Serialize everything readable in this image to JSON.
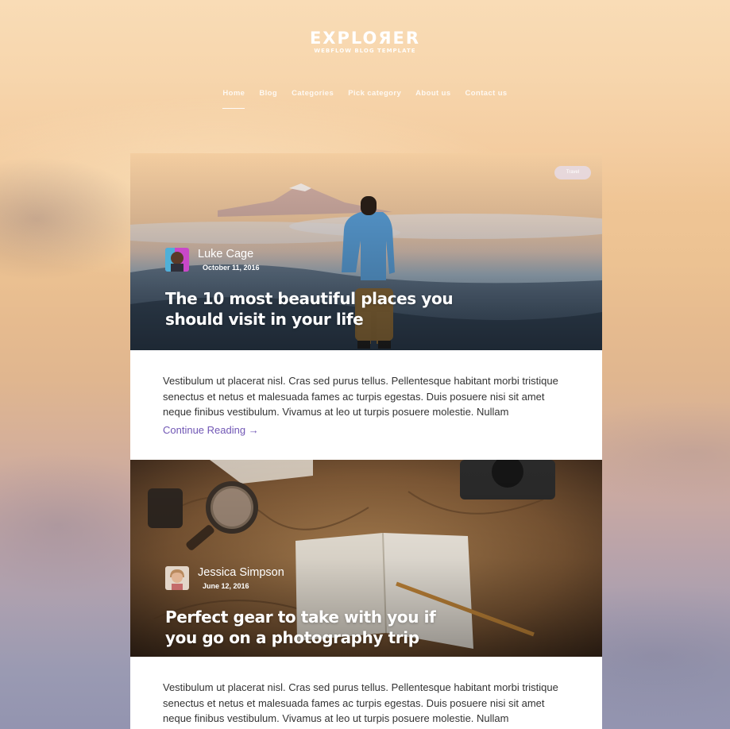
{
  "site": {
    "logo_title": "EXPLOЯER",
    "logo_subtitle": "WEBFLOW BLOG TEMPLATE"
  },
  "nav": {
    "items": [
      {
        "label": "Home"
      },
      {
        "label": "Blog"
      },
      {
        "label": "Categories"
      },
      {
        "label": "Pick category"
      },
      {
        "label": "About us"
      },
      {
        "label": "Contact us"
      }
    ]
  },
  "posts": [
    {
      "tag": "Travel",
      "author": "Luke Cage",
      "date": "October 11, 2016",
      "title": "The 10 most beautiful places you should visit in your life",
      "excerpt": "Vestibulum ut placerat nisl. Cras sed purus tellus. Pellentesque habitant morbi tristique senectus et netus et malesuada fames ac turpis egestas. Duis posuere nisi sit amet neque finibus vestibulum. Vivamus at leo ut turpis posuere molestie. Nullam",
      "read_more": "Continue Reading →"
    },
    {
      "author": "Jessica Simpson",
      "date": "June 12, 2016",
      "title": "Perfect gear to take with you if you go on a photography trip",
      "excerpt": "Vestibulum ut placerat nisl. Cras sed purus tellus. Pellentesque habitant morbi tristique senectus et netus et malesuada fames ac turpis egestas. Duis posuere nisi sit amet neque finibus vestibulum. Vivamus at leo ut turpis posuere molestie. Nullam"
    }
  ],
  "colors": {
    "accent": "#7157b5",
    "text": "#333333"
  }
}
